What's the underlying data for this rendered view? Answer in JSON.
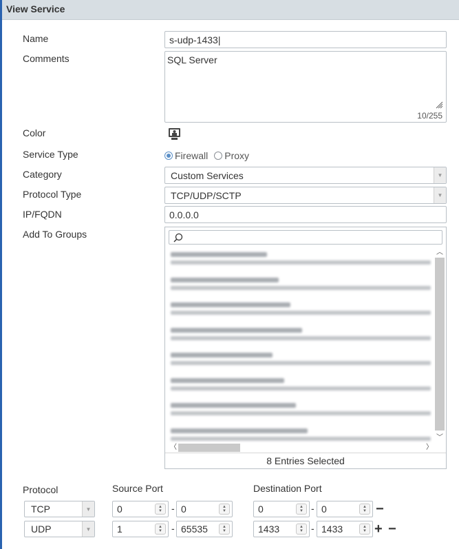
{
  "header": {
    "title": "View Service"
  },
  "form": {
    "name_label": "Name",
    "name_value": "s-udp-1433|",
    "comments_label": "Comments",
    "comments_value": "SQL Server",
    "comments_count": "10/255",
    "color_label": "Color",
    "service_type_label": "Service Type",
    "service_type_options": [
      "Firewall",
      "Proxy"
    ],
    "service_type_selected": "Firewall",
    "category_label": "Category",
    "category_value": "Custom Services",
    "protocol_type_label": "Protocol Type",
    "protocol_type_value": "TCP/UDP/SCTP",
    "ip_fqdn_label": "IP/FQDN",
    "ip_fqdn_value": "0.0.0.0",
    "groups_label": "Add To Groups",
    "groups_footer": "8 Entries Selected",
    "groups_item_count": 8
  },
  "ports": {
    "protocol_header": "Protocol",
    "source_header": "Source Port",
    "dest_header": "Destination Port",
    "separator": "-",
    "rows": [
      {
        "protocol": "TCP",
        "src_low": "0",
        "src_high": "0",
        "dst_low": "0",
        "dst_high": "0"
      },
      {
        "protocol": "UDP",
        "src_low": "1",
        "src_high": "65535",
        "dst_low": "1433",
        "dst_high": "1433"
      }
    ]
  },
  "icons": {
    "color_swatch": "monitor-icon",
    "search": "search-icon",
    "add": "plus-icon",
    "remove": "minus-icon"
  }
}
